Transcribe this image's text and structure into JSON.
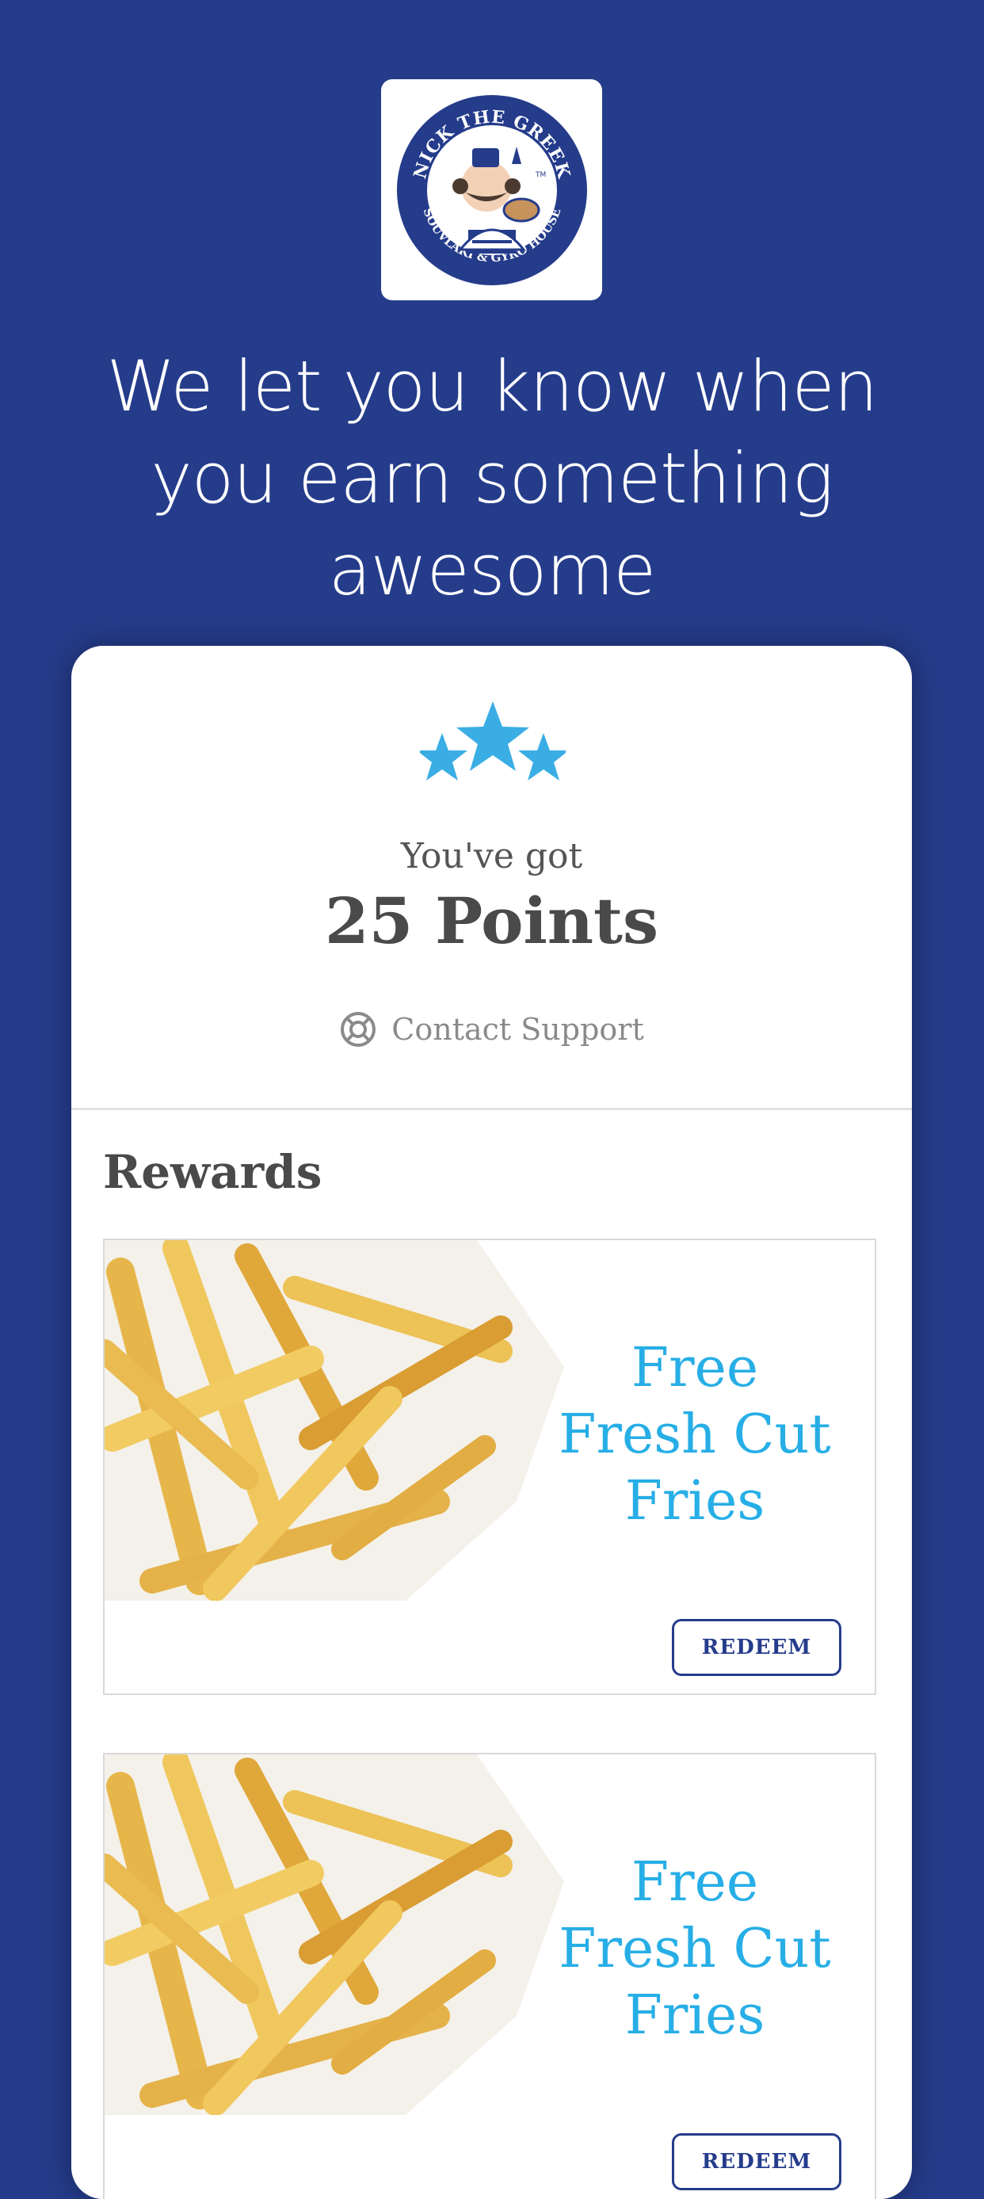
{
  "logo": {
    "line_top": "NICK THE GREEK",
    "line_bottom": "SOUVLAKI & GYRO HOUSE",
    "tm": "TM"
  },
  "headline": "We let you know when you earn something awesome",
  "points_card": {
    "youve_got": "You've got",
    "points": "25 Points",
    "support_label": "Contact Support"
  },
  "rewards": {
    "title": "Rewards",
    "items": [
      {
        "lines": [
          "Free",
          "Fresh Cut",
          "Fries"
        ],
        "button": "REDEEM"
      },
      {
        "lines": [
          "Free",
          "Fresh Cut",
          "Fries"
        ],
        "button": "REDEEM"
      }
    ]
  },
  "colors": {
    "background": "#253c8b",
    "accent": "#27aee6",
    "star": "#3aaee4",
    "text": "#4a4a4a"
  }
}
